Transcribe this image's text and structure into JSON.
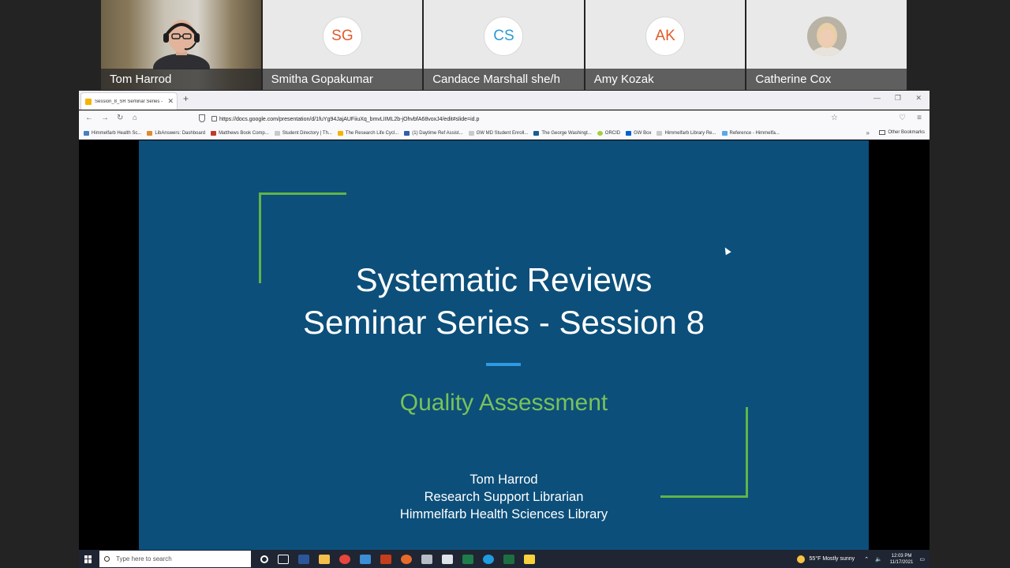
{
  "participants": [
    {
      "name": "Tom Harrod",
      "type": "video"
    },
    {
      "name": "Smitha Gopakumar",
      "initials": "SG",
      "type": "initials",
      "color": "#e05a2b"
    },
    {
      "name": "Candace Marshall she/h",
      "initials": "CS",
      "type": "initials",
      "color": "#2a9ad6"
    },
    {
      "name": "Amy Kozak",
      "initials": "AK",
      "type": "initials",
      "color": "#e05a2b"
    },
    {
      "name": "Catherine Cox",
      "type": "photo"
    }
  ],
  "browser": {
    "tab_title": "Session_8_SR Seminar Series - G",
    "url": "https://docs.google.com/presentation/d/1fuYg94JajAUFiiuXq_bmvLIIML2b-jOhvbfA68voxJ4/edit#slide=id.p",
    "bookmarks": [
      "Himmelfarb Health Sc...",
      "LibAnswers: Dashboard",
      "Matthews Book Comp...",
      "Student Directory | Th...",
      "The Research Life Cycl...",
      "(1) Daytime Ref Assist...",
      "GW MD Student Enroll...",
      "The George Washingt...",
      "ORCID",
      "GW Box",
      "Himmelfarb Library Re...",
      "Reference - Himmelfa..."
    ],
    "other_bookmarks": "Other Bookmarks"
  },
  "slide": {
    "title_line1": "Systematic Reviews",
    "title_line2": "Seminar Series - Session 8",
    "subtitle": "Quality Assessment",
    "presenter_name": "Tom Harrod",
    "presenter_role": "Research Support Librarian",
    "presenter_org": "Himmelfarb Health Sciences Library",
    "accent_green": "#5fb548",
    "background": "#0c4f7a"
  },
  "taskbar": {
    "search_placeholder": "Type here to search",
    "weather": "55°F  Mostly sunny",
    "time": "12:03 PM",
    "date": "11/17/2021"
  }
}
